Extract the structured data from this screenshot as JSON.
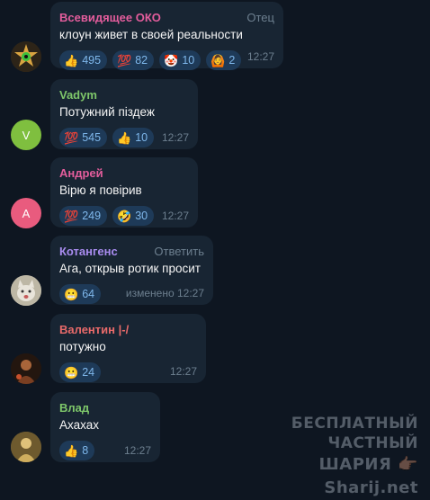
{
  "messages": [
    {
      "name": "Всевидящее ОКО",
      "name_color": "#e35d9c",
      "tag": "Отец",
      "text": "клоун живет в своей реальности",
      "avatar": {
        "icon": "eye-emblem-avatar",
        "letter": ""
      },
      "reactions": [
        {
          "icon": "thumbs-up",
          "emoji": "👍",
          "count": "495"
        },
        {
          "icon": "hundred-points",
          "emoji": "💯",
          "count": "82"
        },
        {
          "icon": "clown-face",
          "emoji": "🤡",
          "count": "10"
        },
        {
          "icon": "person-gesturing",
          "emoji": "🙆",
          "count": "2"
        }
      ],
      "time": "12:27"
    },
    {
      "name": "Vadym",
      "name_color": "#7ec76a",
      "tag": "",
      "text": "Потужний піздеж",
      "avatar": {
        "letter": "V",
        "color": "#7fbf3f"
      },
      "reactions": [
        {
          "icon": "hundred-points",
          "emoji": "💯",
          "count": "545"
        },
        {
          "icon": "thumbs-up",
          "emoji": "👍",
          "count": "10"
        }
      ],
      "time": "12:27"
    },
    {
      "name": "Андрей",
      "name_color": "#e35d9c",
      "tag": "",
      "text": "Вірю я повірив",
      "avatar": {
        "letter": "А",
        "color": "#e95b7e"
      },
      "reactions": [
        {
          "icon": "hundred-points",
          "emoji": "💯",
          "count": "249"
        },
        {
          "icon": "rolling-laughing",
          "emoji": "🤣",
          "count": "30"
        }
      ],
      "time": "12:27"
    },
    {
      "name": "Котангенс",
      "name_color": "#a98cf0",
      "tag": "Ответить",
      "text": "Ага, открыв ротик просит",
      "avatar": {
        "icon": "cat-photo-avatar",
        "letter": ""
      },
      "reactions": [
        {
          "icon": "grimacing-face",
          "emoji": "😬",
          "count": "64"
        }
      ],
      "time": "изменено 12:27"
    },
    {
      "name": "Валентин |-/",
      "name_color": "#e86a6a",
      "tag": "",
      "text": "потужно",
      "avatar": {
        "icon": "dark-photo-avatar",
        "letter": ""
      },
      "reactions": [
        {
          "icon": "grimacing-face",
          "emoji": "😬",
          "count": "24"
        }
      ],
      "time": "12:27"
    },
    {
      "name": "Влад",
      "name_color": "#7ec76a",
      "tag": "",
      "text": "Ахахах",
      "avatar": {
        "icon": "gold-photo-avatar",
        "letter": ""
      },
      "reactions": [
        {
          "icon": "thumbs-up",
          "emoji": "👍",
          "count": "8"
        }
      ],
      "time": "12:27"
    }
  ],
  "watermark": {
    "line1": "БЕСПЛАТНЫЙ ЧАСТНЫЙ",
    "line2": "ШАРИЯ 👉🏿 Sharij.net"
  },
  "colors": {
    "background": "#0e1621",
    "bubble": "#182533",
    "reaction_bg": "#1e3a58",
    "reaction_text": "#7fb8ec",
    "meta_text": "#6d7f8f"
  }
}
